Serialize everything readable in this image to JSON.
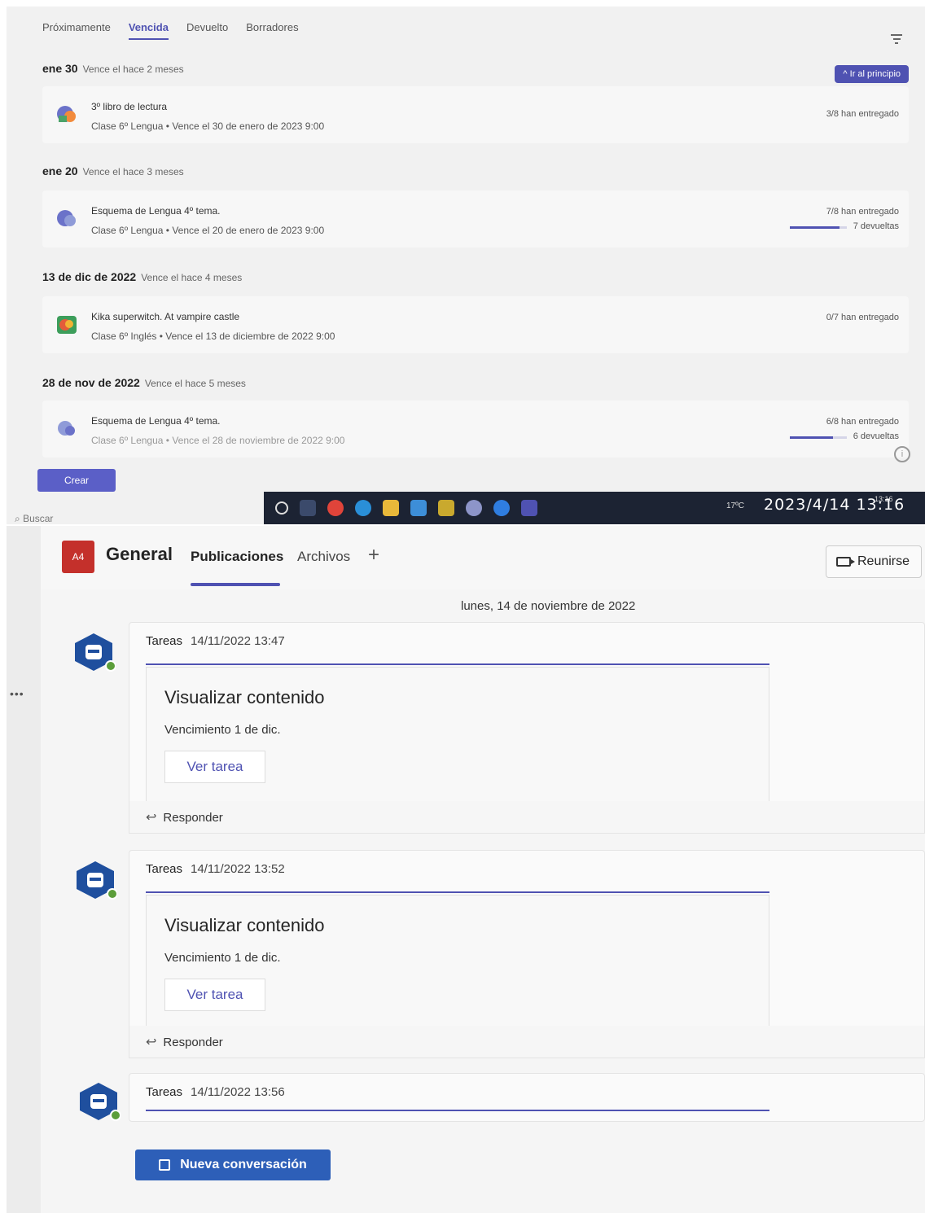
{
  "assignments": {
    "tabs": [
      {
        "label": "Próximamente"
      },
      {
        "label": "Vencida"
      },
      {
        "label": "Devuelto"
      },
      {
        "label": "Borradores"
      }
    ],
    "back_to_top": "Ir al principio",
    "groups": [
      {
        "date": "ene 30",
        "relative": "Vence el hace 2 meses",
        "item": {
          "title": "3º libro de lectura",
          "meta": "Clase 6º Lengua • Vence el 30 de enero de 2023 9:00",
          "handed_in": "3/8 han entregado"
        }
      },
      {
        "date": "ene 20",
        "relative": "Vence el hace 3 meses",
        "item": {
          "title": "Esquema de Lengua 4º tema.",
          "meta": "Clase 6º Lengua • Vence el 20 de enero de 2023 9:00",
          "handed_in": "7/8 han entregado",
          "returned": "7 devueltas",
          "returned_fraction": 0.875
        }
      },
      {
        "date": "13 de dic de 2022",
        "relative": "Vence el hace 4 meses",
        "item": {
          "title": "Kika superwitch. At vampire castle",
          "meta": "Clase 6º Inglés • Vence el 13 de diciembre de 2022 9:00",
          "handed_in": "0/7 han entregado"
        }
      },
      {
        "date": "28 de nov de 2022",
        "relative": "Vence el hace 5 meses",
        "item": {
          "title": "Esquema de Lengua 4º tema.",
          "meta": "Clase 6º Lengua • Vence el 28 de noviembre de 2022 9:00",
          "handed_in": "6/8 han entregado",
          "returned": "6 devueltas",
          "returned_fraction": 0.75
        }
      }
    ],
    "create_label": "Crear",
    "search_placeholder": "Buscar",
    "taskbar": {
      "weather": "17ºC",
      "clock": "13:16"
    },
    "photo_timestamp": "2023/4/14 13:16"
  },
  "channel": {
    "team_initials": "A4",
    "name": "General",
    "tabs": [
      {
        "label": "Publicaciones"
      },
      {
        "label": "Archivos"
      }
    ],
    "add_tab": "+",
    "meet_label": "Reunirse",
    "date_divider": "lunes, 14 de noviembre de 2022",
    "posts": [
      {
        "author": "Tareas",
        "time": "14/11/2022 13:47",
        "card_title": "Visualizar contenido",
        "card_due": "Vencimiento 1 de dic.",
        "card_button": "Ver tarea",
        "reply": "Responder"
      },
      {
        "author": "Tareas",
        "time": "14/11/2022 13:52",
        "card_title": "Visualizar contenido",
        "card_due": "Vencimiento 1 de dic.",
        "card_button": "Ver tarea",
        "reply": "Responder"
      },
      {
        "author": "Tareas",
        "time": "14/11/2022 13:56"
      }
    ],
    "new_conversation": "Nueva conversación"
  },
  "colors": {
    "accent": "#4f52b2",
    "team_avatar": "#c4302b",
    "new_conversation": "#2d5fb8"
  }
}
